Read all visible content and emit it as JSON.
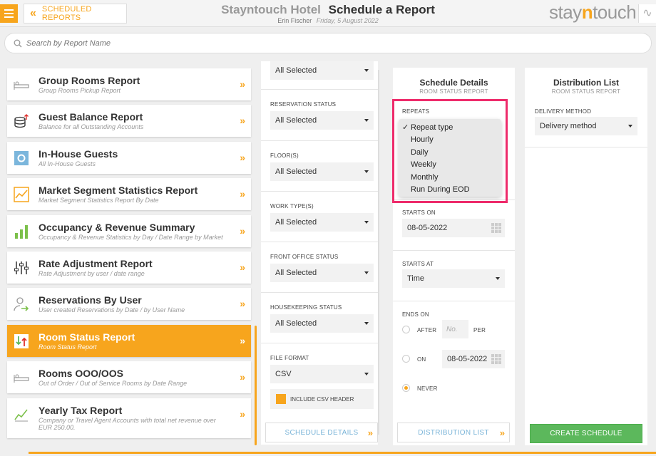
{
  "header": {
    "back_label": "SCHEDULED REPORTS",
    "back_icon": "double-chevron-left-icon",
    "hotel_name": "Stayntouch Hotel",
    "page_title": "Schedule a Report",
    "user_name": "Erin Fischer",
    "date": "Friday, 5 August 2022",
    "logo_text_a": "stay",
    "logo_text_n": "n",
    "logo_text_b": "touch"
  },
  "search": {
    "placeholder": "Search by Report Name"
  },
  "reports": [
    {
      "name": "Group Rooms Report",
      "desc": "Group Rooms Pickup Report",
      "icon": "bed-icon",
      "arrow": "»"
    },
    {
      "name": "Guest Balance Report",
      "desc": "Balance for all Outstanding Accounts",
      "icon": "coins-icon",
      "arrow": "»"
    },
    {
      "name": "In-House Guests",
      "desc": "All In-House Guests",
      "icon": "in-house-icon",
      "arrow": "»"
    },
    {
      "name": "Market Segment Statistics Report",
      "desc": "Market Segment Statistics Report By Date",
      "icon": "line-chart-icon",
      "arrow": "»"
    },
    {
      "name": "Occupancy & Revenue Summary",
      "desc": "Occupancy & Revenue Statistics by Day / Date Range by Market",
      "icon": "bar-chart-icon",
      "arrow": "»"
    },
    {
      "name": "Rate Adjustment Report",
      "desc": "Rate Adjustment by user / date range",
      "icon": "sliders-icon",
      "arrow": "»"
    },
    {
      "name": "Reservations By User",
      "desc": "User created Reservations by Date / by User Name",
      "icon": "user-arrow-icon",
      "arrow": "»"
    },
    {
      "name": "Room Status Report",
      "desc": "Room Status Report",
      "icon": "room-status-icon",
      "arrow": "»",
      "active": true
    },
    {
      "name": "Rooms OOO/OOS",
      "desc": "Out of Order / Out of Service Rooms by Date Range",
      "icon": "bed-icon",
      "arrow": "»"
    },
    {
      "name": "Yearly Tax Report",
      "desc": "Company or Travel Agent Accounts with total net revenue over EUR 250.00.",
      "icon": "trend-icon",
      "arrow": "»"
    }
  ],
  "filters": {
    "top_select": "All Selected",
    "reservation_status": {
      "label": "RESERVATION STATUS",
      "value": "All Selected"
    },
    "floors": {
      "label": "FLOOR(S)",
      "value": "All Selected"
    },
    "work_types": {
      "label": "WORK TYPE(S)",
      "value": "All Selected"
    },
    "front_office_status": {
      "label": "FRONT OFFICE STATUS",
      "value": "All Selected"
    },
    "housekeeping_status": {
      "label": "HOUSEKEEPING STATUS",
      "value": "All Selected"
    },
    "file_format": {
      "label": "FILE FORMAT",
      "value": "CSV"
    },
    "include_csv_header": "INCLUDE CSV HEADER",
    "schedule_details_button": "SCHEDULE DETAILS"
  },
  "schedule": {
    "title": "Schedule Details",
    "subtitle": "ROOM STATUS REPORT",
    "repeats_label": "REPEATS",
    "repeat_options": [
      "Repeat type",
      "Hourly",
      "Daily",
      "Weekly",
      "Monthly",
      "Run During EOD"
    ],
    "repeat_selected": "Repeat type",
    "check_mark": "✓",
    "starts_on_label": "STARTS ON",
    "starts_on_value": "08-05-2022",
    "starts_at_label": "STARTS AT",
    "starts_at_value": "Time",
    "ends_on_label": "ENDS ON",
    "after_label": "AFTER",
    "after_placeholder": "No.",
    "per_label": "PER",
    "on_label": "ON",
    "on_value": "08-05-2022",
    "never_label": "NEVER",
    "distribution_list_button": "DISTRIBUTION LIST"
  },
  "distribution": {
    "title": "Distribution List",
    "subtitle": "ROOM STATUS REPORT",
    "delivery_label": "DELIVERY METHOD",
    "delivery_value": "Delivery method",
    "create_button": "CREATE SCHEDULE"
  },
  "colors": {
    "accent": "#f7a51d",
    "highlight": "#ee2b6b",
    "create": "#5cb85c",
    "link": "#7ab4d8"
  }
}
